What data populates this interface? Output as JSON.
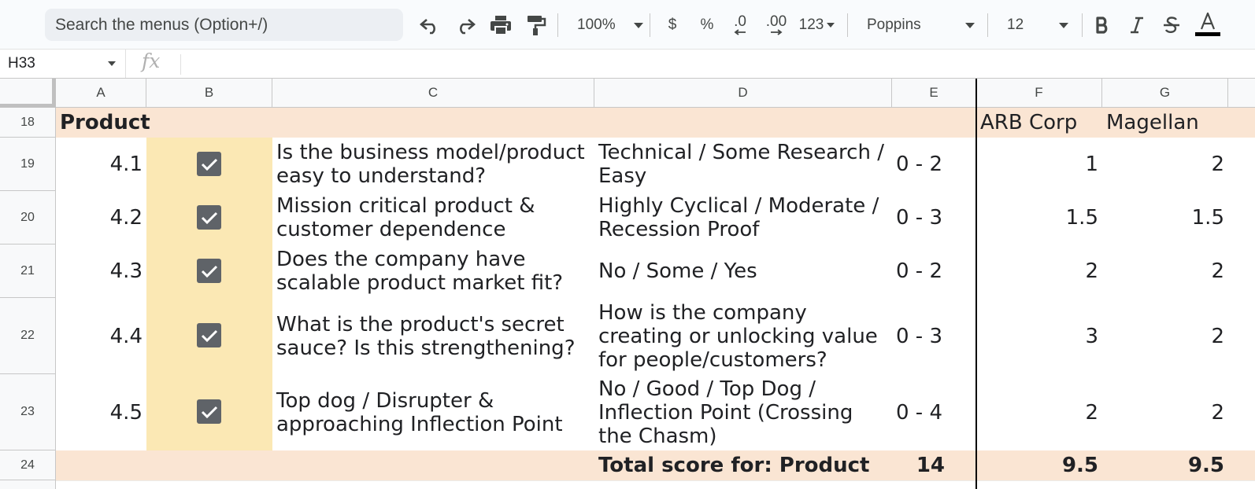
{
  "toolbar": {
    "search_placeholder": "Search the menus (Option+/)",
    "zoom": "100%",
    "currency": "$",
    "percent": "%",
    "decrease_decimal": ".0",
    "increase_decimal": ".00",
    "more_formats": "123",
    "font": "Poppins",
    "font_size": "12",
    "text_color": "#000000"
  },
  "formula_bar": {
    "cell_ref": "H33",
    "fx_label": "fx",
    "formula": ""
  },
  "columns": [
    "A",
    "B",
    "C",
    "D",
    "E",
    "F",
    "G"
  ],
  "colors": {
    "section_band": "#fae5d3",
    "checkbox_column": "#fbe8b4",
    "checkbox_fill": "#5f6368"
  },
  "section": {
    "row_number": "18",
    "title": "Product",
    "company_1": "ARB Corp",
    "company_2": "Magellan"
  },
  "rows": [
    {
      "row_number": "19",
      "id": "4.1",
      "checked": true,
      "question": "Is the business model/product easy to understand?",
      "scale": "Technical / Some Research / Easy",
      "range": "0 - 2",
      "score_1": "1",
      "score_2": "2"
    },
    {
      "row_number": "20",
      "id": "4.2",
      "checked": true,
      "question": "Mission critical product & customer dependence",
      "scale": "Highly Cyclical / Moderate / Recession Proof",
      "range": "0 - 3",
      "score_1": "1.5",
      "score_2": "1.5"
    },
    {
      "row_number": "21",
      "id": "4.3",
      "checked": true,
      "question": "Does the company have scalable product market fit?",
      "scale": "No / Some / Yes",
      "range": "0 - 2",
      "score_1": "2",
      "score_2": "2"
    },
    {
      "row_number": "22",
      "id": "4.4",
      "checked": true,
      "question": "What is the product's secret sauce? Is this strengthening?",
      "scale": "How is the company creating or unlocking value for people/customers?",
      "range": "0 - 3",
      "score_1": "3",
      "score_2": "2"
    },
    {
      "row_number": "23",
      "id": "4.5",
      "checked": true,
      "question": "Top dog / Disrupter & approaching Inflection Point",
      "scale": "No / Good / Top Dog / Inflection Point (Crossing the Chasm)",
      "range": "0 - 4",
      "score_1": "2",
      "score_2": "2"
    }
  ],
  "total": {
    "row_number": "24",
    "label": "Total score for: Product",
    "max": "14",
    "score_1": "9.5",
    "score_2": "9.5"
  }
}
